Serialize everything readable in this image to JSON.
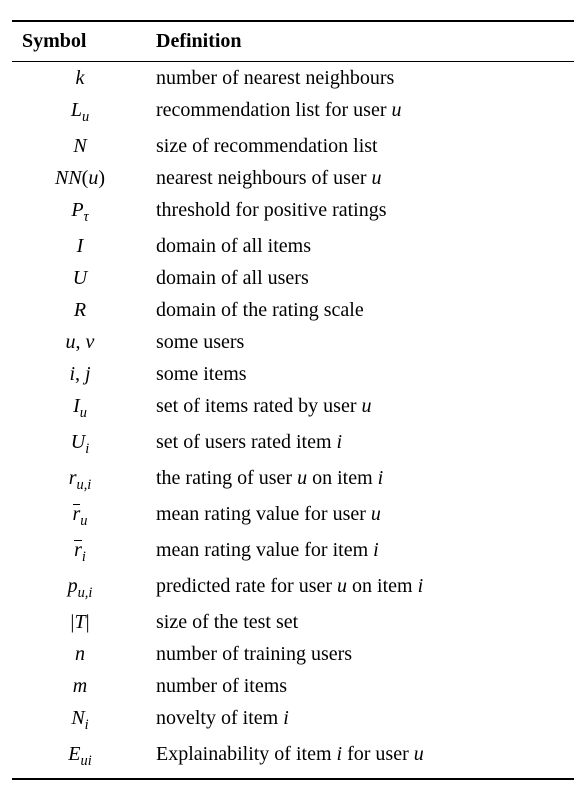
{
  "headers": {
    "symbol": "Symbol",
    "definition": "Definition"
  },
  "rows": [
    {
      "symbol_html": "k",
      "definition_html": "number of nearest neighbours"
    },
    {
      "symbol_html": "L<span class='sub'>u</span>",
      "definition_html": "recommendation list for user <span class='it'>u</span>"
    },
    {
      "symbol_html": "N",
      "definition_html": "size of recommendation list"
    },
    {
      "symbol_html": "NN<span class='rm'>(</span>u<span class='rm'>)</span>",
      "definition_html": "nearest neighbours of user <span class='it'>u</span>"
    },
    {
      "symbol_html": "P<span class='sub'>τ</span>",
      "definition_html": "threshold for positive ratings"
    },
    {
      "symbol_html": "I",
      "definition_html": "domain of all items"
    },
    {
      "symbol_html": "U",
      "definition_html": "domain of all users"
    },
    {
      "symbol_html": "R",
      "definition_html": "domain of the rating scale"
    },
    {
      "symbol_html": "u<span class='rm'>,</span>&nbsp;v",
      "definition_html": "some users"
    },
    {
      "symbol_html": "i<span class='rm'>,</span>&nbsp;j",
      "definition_html": "some items"
    },
    {
      "symbol_html": "I<span class='sub'>u</span>",
      "definition_html": "set of items rated by user <span class='it'>u</span>"
    },
    {
      "symbol_html": "U<span class='sub'>i</span>",
      "definition_html": "set of users rated item <span class='it'>i</span>"
    },
    {
      "symbol_html": "r<span class='sub'>u,i</span>",
      "definition_html": "the rating of user <span class='it'>u</span> on item <span class='it'>i</span>"
    },
    {
      "symbol_html": "<span class='bar'>r</span><span class='sub'>u</span>",
      "definition_html": "mean rating value for user <span class='it'>u</span>"
    },
    {
      "symbol_html": "<span class='bar'>r</span><span class='sub'>i</span>",
      "definition_html": "mean rating value for item <span class='it'>i</span>"
    },
    {
      "symbol_html": "p<span class='sub'>u,i</span>",
      "definition_html": "predicted rate for user <span class='it'>u</span> on item <span class='it'>i</span>"
    },
    {
      "symbol_html": "<span class='rm'>|</span>T<span class='rm'>|</span>",
      "definition_html": "size of the test set"
    },
    {
      "symbol_html": "n",
      "definition_html": "number of training users"
    },
    {
      "symbol_html": "m",
      "definition_html": "number of items"
    },
    {
      "symbol_html": "N<span class='sub'>i</span>",
      "definition_html": "novelty of item <span class='it'>i</span>"
    },
    {
      "symbol_html": "E<span class='sub'>ui</span>",
      "definition_html": "Explainability of item <span class='it'>i</span> for user <span class='it'>u</span>"
    }
  ],
  "chart_data": {
    "type": "table",
    "columns": [
      "Symbol",
      "Definition"
    ],
    "rows": [
      [
        "k",
        "number of nearest neighbours"
      ],
      [
        "L_u",
        "recommendation list for user u"
      ],
      [
        "N",
        "size of recommendation list"
      ],
      [
        "NN(u)",
        "nearest neighbours of user u"
      ],
      [
        "P_τ",
        "threshold for positive ratings"
      ],
      [
        "I",
        "domain of all items"
      ],
      [
        "U",
        "domain of all users"
      ],
      [
        "R",
        "domain of the rating scale"
      ],
      [
        "u, v",
        "some users"
      ],
      [
        "i, j",
        "some items"
      ],
      [
        "I_u",
        "set of items rated by user u"
      ],
      [
        "U_i",
        "set of users rated item i"
      ],
      [
        "r_{u,i}",
        "the rating of user u on item i"
      ],
      [
        "r̄_u",
        "mean rating value for user u"
      ],
      [
        "r̄_i",
        "mean rating value for item i"
      ],
      [
        "p_{u,i}",
        "predicted rate for user u on item i"
      ],
      [
        "|T|",
        "size of the test set"
      ],
      [
        "n",
        "number of training users"
      ],
      [
        "m",
        "number of items"
      ],
      [
        "N_i",
        "novelty of item i"
      ],
      [
        "E_{ui}",
        "Explainability of item i for user u"
      ]
    ]
  }
}
